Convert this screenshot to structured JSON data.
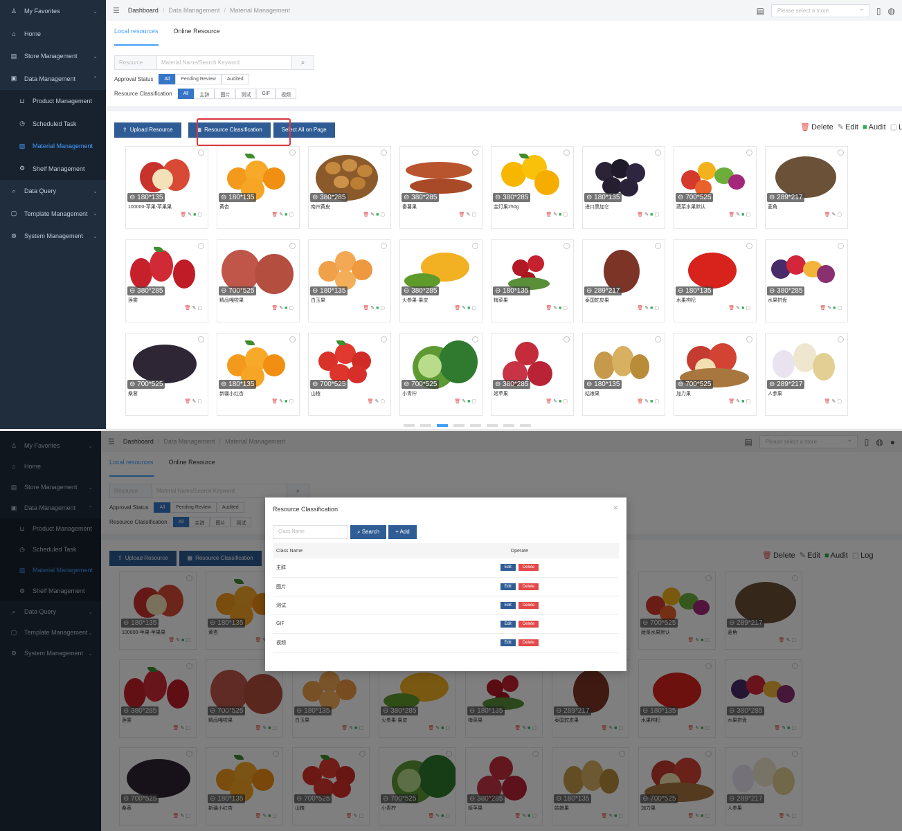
{
  "breadcrumb": [
    "Dashboard",
    "Data Management",
    "Material Management"
  ],
  "store_select": {
    "placeholder": "Please select a store"
  },
  "sidebar": {
    "items": [
      {
        "label": "My Favorites",
        "icon": "user-icon",
        "arrow": true
      },
      {
        "label": "Home",
        "icon": "home-icon",
        "arrow": false
      },
      {
        "label": "Store Management",
        "icon": "store-icon",
        "arrow": true
      },
      {
        "label": "Data Management",
        "icon": "database-icon",
        "arrow": true
      },
      {
        "label": "Product Management",
        "icon": "cart-icon",
        "sub": true
      },
      {
        "label": "Scheduled Task",
        "icon": "clock-icon",
        "sub": true
      },
      {
        "label": "Material Management",
        "icon": "picture-icon",
        "sub": true,
        "active": true
      },
      {
        "label": "Shelf Management",
        "icon": "shelf-icon",
        "sub": true
      },
      {
        "label": "Data Query",
        "icon": "search-icon",
        "arrow": true
      },
      {
        "label": "Template Management",
        "icon": "template-icon",
        "arrow": true
      },
      {
        "label": "System Management",
        "icon": "settings-icon",
        "arrow": true
      }
    ]
  },
  "tabs": [
    "Local resources",
    "Online Resource"
  ],
  "search": {
    "select": "Resource",
    "placeholder": "Material Name/Search Keyword"
  },
  "approval": {
    "label": "Approval Status",
    "options": [
      "All",
      "Pending Review",
      "Audited"
    ]
  },
  "classification": {
    "label": "Resource Classification",
    "options": [
      "All",
      "主辞",
      "图片",
      "测试",
      "GIF",
      "视频"
    ]
  },
  "actions": {
    "upload": "Upload Resource",
    "classify": "Resource Classification",
    "select_all": "Select All on Page"
  },
  "legend": {
    "delete": "Delete",
    "edit": "Edit",
    "audit": "Audit",
    "log": "Log"
  },
  "cards": [
    {
      "size": "180*135",
      "name": "100000-苹果-苹果果",
      "fruit": "apple",
      "audit": true
    },
    {
      "size": "180*135",
      "name": "黄杏",
      "fruit": "orange",
      "audit": true
    },
    {
      "size": "380*285",
      "name": "南州黄皮",
      "fruit": "longan",
      "audit": true
    },
    {
      "size": "380*285",
      "name": "番薯果",
      "fruit": "sweetpotato",
      "audit": false
    },
    {
      "size": "380*285",
      "name": "金灯果250g",
      "fruit": "physalis",
      "audit": true
    },
    {
      "size": "180*135",
      "name": "进口黑加仑",
      "fruit": "grape",
      "audit": true
    },
    {
      "size": "700*525",
      "name": "蔬菜水果默认",
      "fruit": "mix",
      "audit": true
    },
    {
      "size": "289*217",
      "name": "菱角",
      "fruit": "caltrop",
      "audit": false
    },
    {
      "size": "380*285",
      "name": "莲雾",
      "fruit": "waxapple",
      "audit": false
    },
    {
      "size": "700*525",
      "name": "精品嘎啦果",
      "fruit": "gala",
      "audit": true
    },
    {
      "size": "180*135",
      "name": "白玉果",
      "fruit": "loquat",
      "audit": true
    },
    {
      "size": "380*285",
      "name": "火参果-果皮",
      "fruit": "kiwano",
      "audit": true
    },
    {
      "size": "180*135",
      "name": "梅菜果",
      "fruit": "berries",
      "audit": true
    },
    {
      "size": "289*217",
      "name": "泰国蛇皮果",
      "fruit": "salak",
      "audit": true
    },
    {
      "size": "180*135",
      "name": "水果枸杞",
      "fruit": "goji",
      "audit": true
    },
    {
      "size": "380*285",
      "name": "水果拼盘",
      "fruit": "platter",
      "audit": true
    },
    {
      "size": "700*525",
      "name": "桑葚",
      "fruit": "mulberry",
      "audit": false
    },
    {
      "size": "180*135",
      "name": "新疆小红杏",
      "fruit": "orange",
      "audit": true
    },
    {
      "size": "700*525",
      "name": "山楂",
      "fruit": "hawthorn",
      "audit": false
    },
    {
      "size": "700*525",
      "name": "小青柠",
      "fruit": "lime",
      "audit": true
    },
    {
      "size": "380*285",
      "name": "姬苹果",
      "fruit": "redapple",
      "audit": true
    },
    {
      "size": "180*135",
      "name": "姑娘果",
      "fruit": "husk",
      "audit": true
    },
    {
      "size": "700*525",
      "name": "加力果",
      "fruit": "applebowl",
      "audit": true
    },
    {
      "size": "289*217",
      "name": "人参果",
      "fruit": "pepino",
      "audit": false
    }
  ],
  "dialog": {
    "title": "Resource Classification",
    "placeholder": "Class Name",
    "search_button": "Search",
    "add_button": "+ Add",
    "col_name": "Class Name",
    "col_operate": "Operate",
    "rows": [
      "主辞",
      "图片",
      "测试",
      "GIF",
      "视频"
    ],
    "edit_label": "Edit",
    "delete_label": "Delete"
  },
  "colors": {
    "sidebar": "#1f2d3d",
    "primary_button": "#2f5c94",
    "accent": "#409eff",
    "danger": "#e34848",
    "audit": "#35a853"
  }
}
